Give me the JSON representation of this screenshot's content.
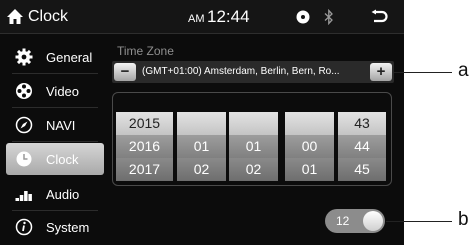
{
  "status_bar": {
    "title": "Clock",
    "ampm": "AM",
    "time": "12:44"
  },
  "sidebar": {
    "items": [
      {
        "label": "General",
        "icon": "gear-icon"
      },
      {
        "label": "Video",
        "icon": "film-reel-icon"
      },
      {
        "label": "NAVI",
        "icon": "compass-icon"
      },
      {
        "label": "Clock",
        "icon": "clock-icon",
        "active": true
      },
      {
        "label": "Audio",
        "icon": "equalizer-icon"
      },
      {
        "label": "System",
        "icon": "info-icon"
      }
    ]
  },
  "time_zone": {
    "label": "Time Zone",
    "value": "(GMT+01:00) Amsterdam, Berlin, Bern, Ro...",
    "minus": "−",
    "plus": "+"
  },
  "picker": {
    "year": [
      "2015",
      "2016",
      "2017"
    ],
    "month": [
      "",
      "01",
      "02"
    ],
    "day": [
      "",
      "01",
      "02"
    ],
    "hour": [
      "",
      "00",
      "01"
    ],
    "minute": [
      "43",
      "44",
      "45"
    ]
  },
  "format_toggle": {
    "label": "12"
  },
  "callouts": {
    "a": "a",
    "b": "b"
  },
  "colors": {
    "background": "#0c0c0c",
    "active_item": "#bdbdbd"
  }
}
